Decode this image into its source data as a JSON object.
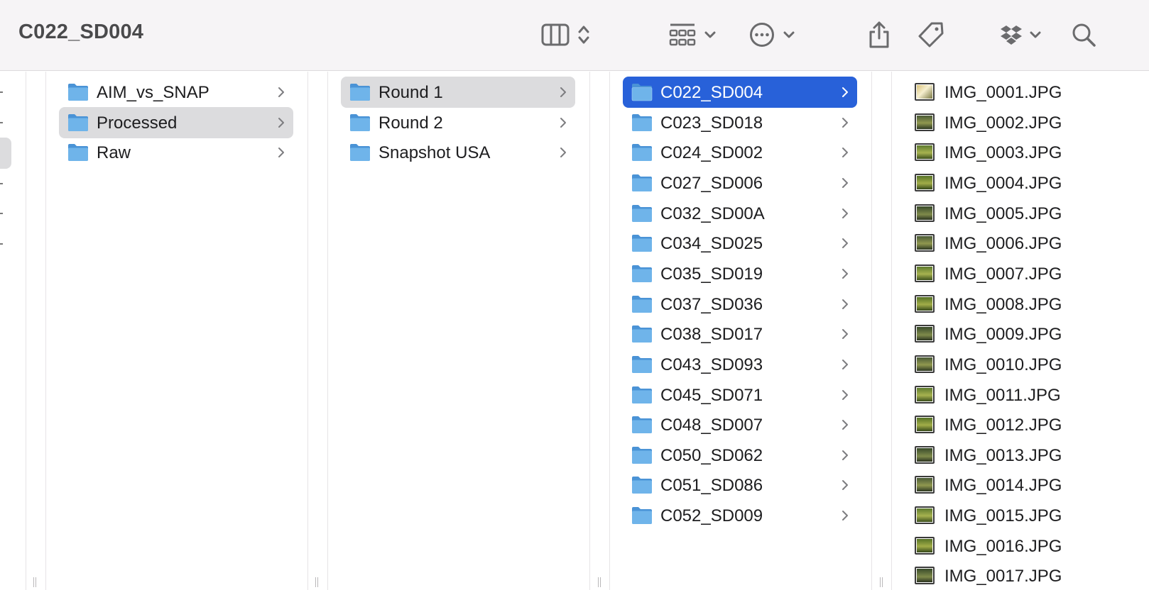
{
  "window": {
    "title": "C022_SD004"
  },
  "toolbar": {
    "icons": [
      "column-view-icon",
      "view-options-chevron-icon",
      "group-icon",
      "more-actions-icon",
      "share-icon",
      "tag-icon",
      "dropbox-icon",
      "search-icon"
    ]
  },
  "colors": {
    "folder": "#6fb4ea",
    "folder_dark": "#4a93d6",
    "selected_blue": "#2861d9",
    "selected_gray": "#dcdcde"
  },
  "columns": [
    {
      "items": [
        {
          "label": "AIM_vs_SNAP",
          "state": "normal"
        },
        {
          "label": "Processed",
          "state": "selected-inactive"
        },
        {
          "label": "Raw",
          "state": "normal"
        }
      ]
    },
    {
      "items": [
        {
          "label": "Round 1",
          "state": "selected-inactive"
        },
        {
          "label": "Round 2",
          "state": "normal"
        },
        {
          "label": "Snapshot USA",
          "state": "normal"
        }
      ]
    },
    {
      "items": [
        {
          "label": "C022_SD004",
          "state": "selected-active"
        },
        {
          "label": "C023_SD018",
          "state": "normal"
        },
        {
          "label": "C024_SD002",
          "state": "normal"
        },
        {
          "label": "C027_SD006",
          "state": "normal"
        },
        {
          "label": "C032_SD00A",
          "state": "normal"
        },
        {
          "label": "C034_SD025",
          "state": "normal"
        },
        {
          "label": "C035_SD019",
          "state": "normal"
        },
        {
          "label": "C037_SD036",
          "state": "normal"
        },
        {
          "label": "C038_SD017",
          "state": "normal"
        },
        {
          "label": "C043_SD093",
          "state": "normal"
        },
        {
          "label": "C045_SD071",
          "state": "normal"
        },
        {
          "label": "C048_SD007",
          "state": "normal"
        },
        {
          "label": "C050_SD062",
          "state": "normal"
        },
        {
          "label": "C051_SD086",
          "state": "normal"
        },
        {
          "label": "C052_SD009",
          "state": "normal"
        }
      ]
    },
    {
      "files": [
        "IMG_0001.JPG",
        "IMG_0002.JPG",
        "IMG_0003.JPG",
        "IMG_0004.JPG",
        "IMG_0005.JPG",
        "IMG_0006.JPG",
        "IMG_0007.JPG",
        "IMG_0008.JPG",
        "IMG_0009.JPG",
        "IMG_0010.JPG",
        "IMG_0011.JPG",
        "IMG_0012.JPG",
        "IMG_0013.JPG",
        "IMG_0014.JPG",
        "IMG_0015.JPG",
        "IMG_0016.JPG",
        "IMG_0017.JPG"
      ]
    }
  ]
}
